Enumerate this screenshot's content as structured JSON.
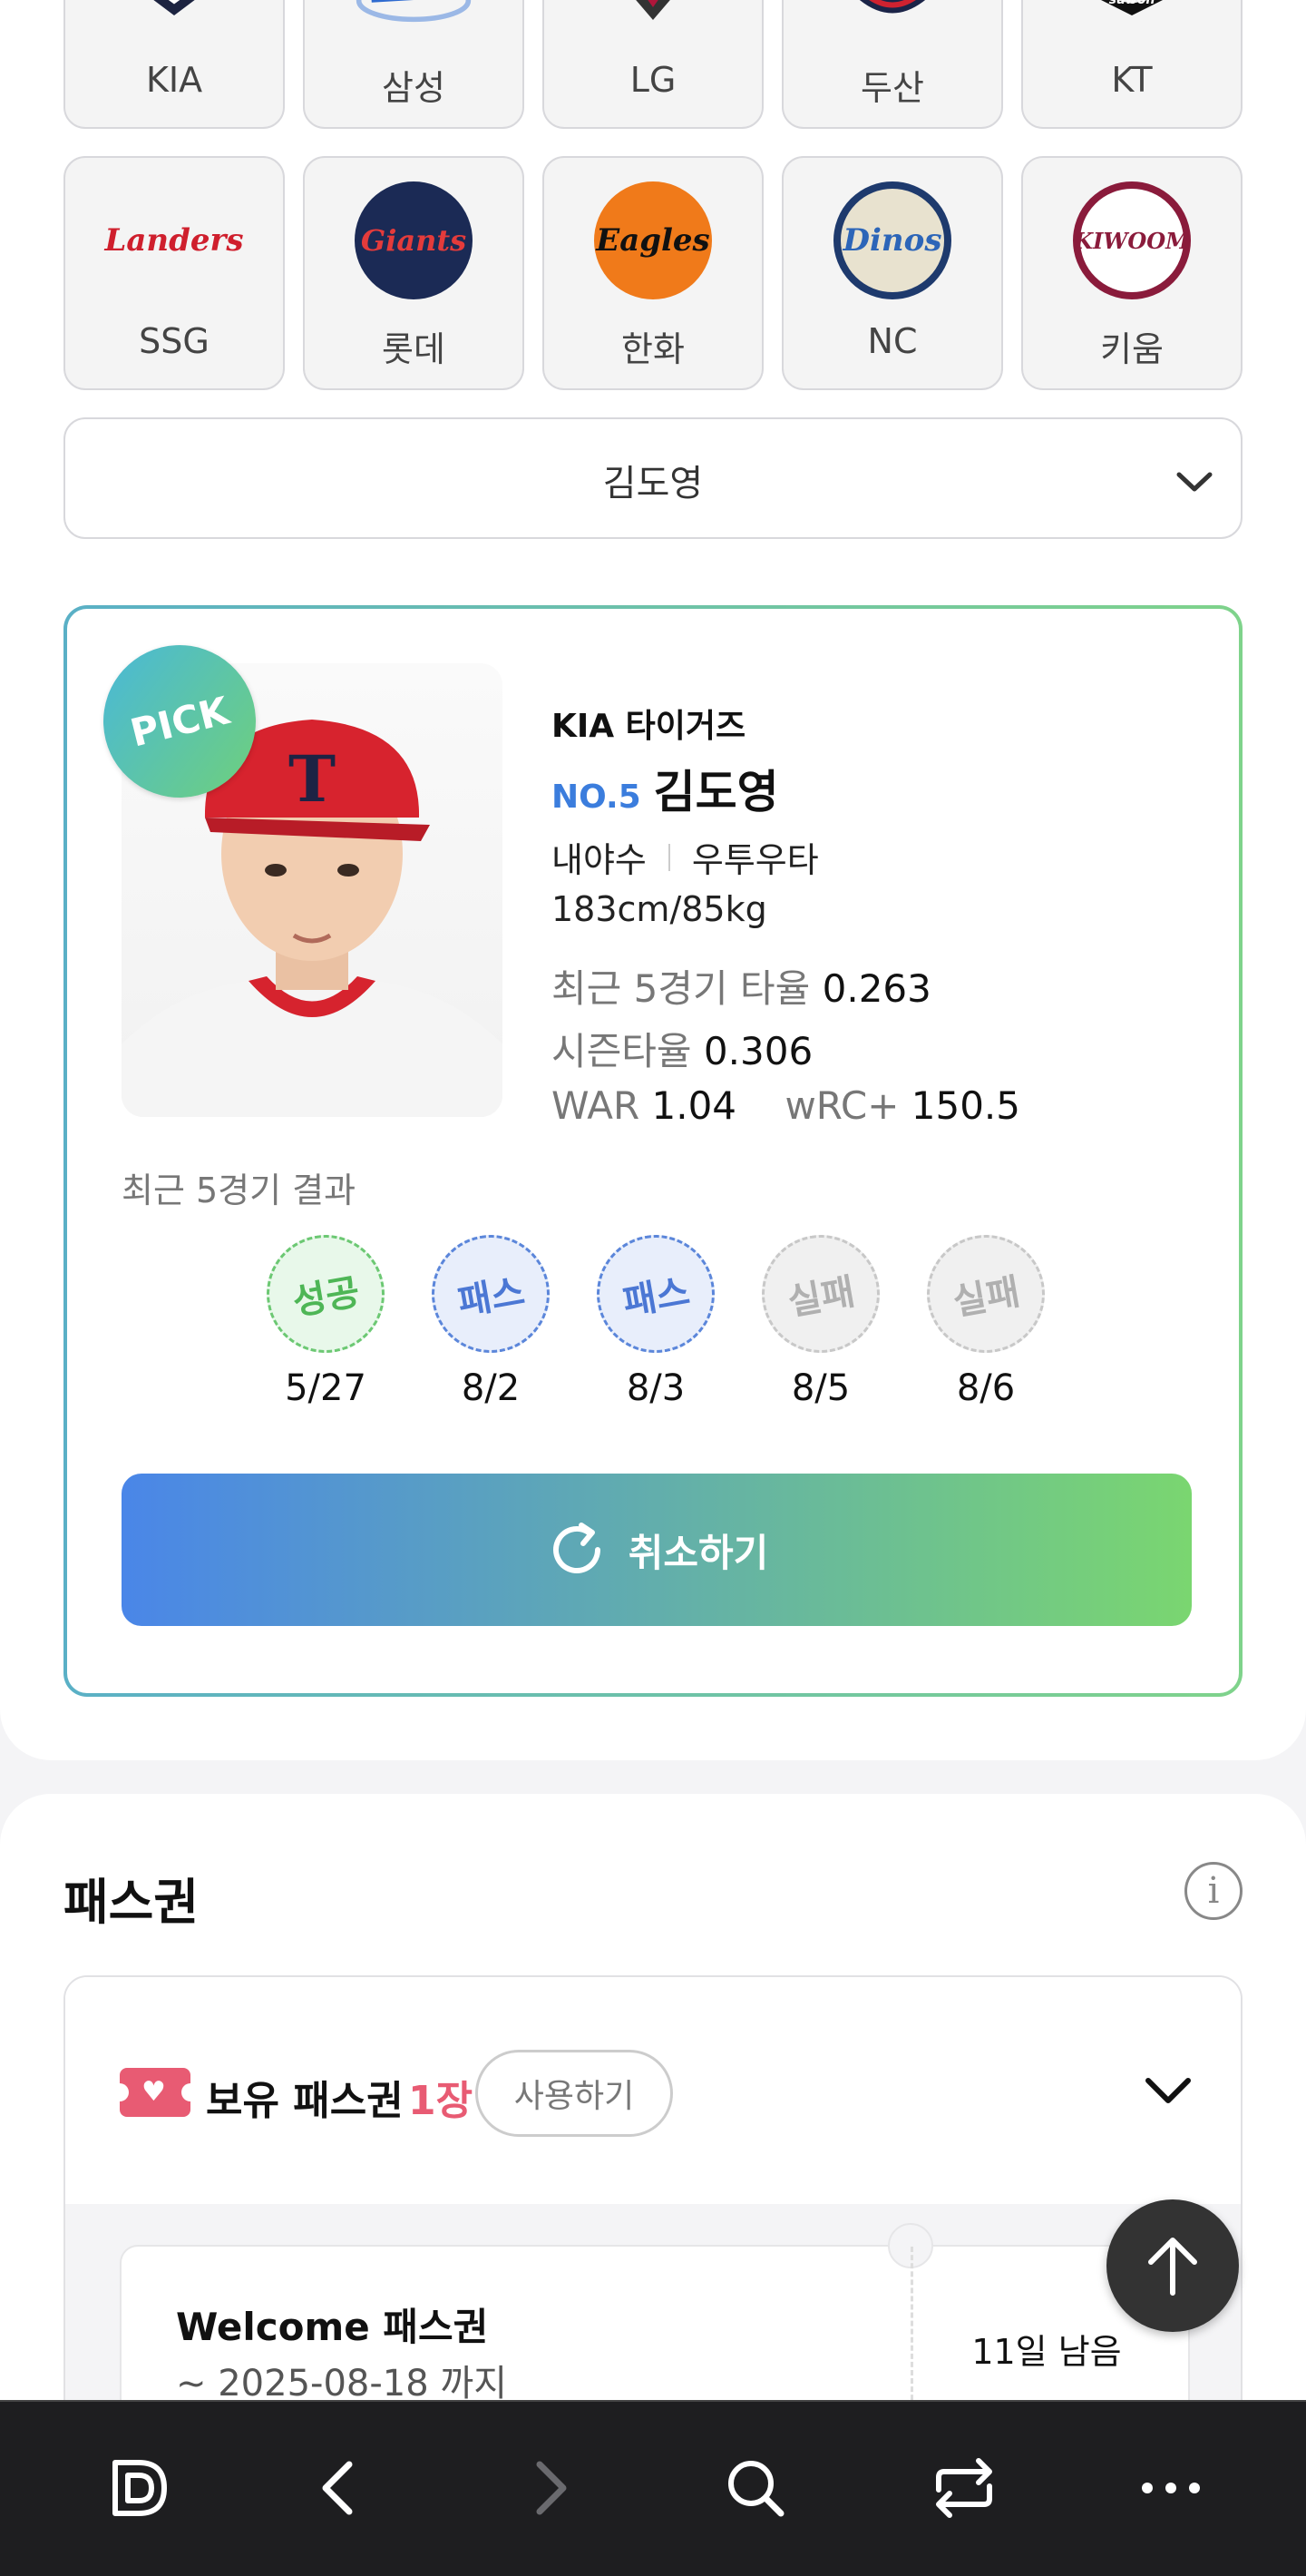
{
  "teams": [
    {
      "name": "KIA",
      "logo_text": "",
      "color": "#1c2340"
    },
    {
      "name": "삼성",
      "logo_text": "",
      "color": "#2f6bd0"
    },
    {
      "name": "LG",
      "logo_text": "",
      "color": "#b0163b"
    },
    {
      "name": "두산",
      "logo_text": "",
      "color": "#1b2448"
    },
    {
      "name": "KT",
      "logo_text": "",
      "color": "#111111"
    },
    {
      "name": "SSG",
      "logo_text": "Landers",
      "color": "#cf1f2d"
    },
    {
      "name": "롯데",
      "logo_text": "Giants",
      "color": "#d8202a"
    },
    {
      "name": "한화",
      "logo_text": "Eagles",
      "color": "#f07a1a"
    },
    {
      "name": "NC",
      "logo_text": "Dinos",
      "color": "#1e3a6d"
    },
    {
      "name": "키움",
      "logo_text": "KIWOOM",
      "color": "#8a1b3b"
    }
  ],
  "player_select": {
    "value": "김도영"
  },
  "pick_card": {
    "badge": "PICK",
    "team_name": "KIA 타이거즈",
    "number": "NO.5",
    "player_name": "김도영",
    "position": "내야수",
    "bats_throws": "우투우타",
    "body": "183cm/85kg",
    "stats": {
      "recent5_label": "최근 5경기 타율",
      "recent5_value": "0.263",
      "season_label": "시즌타율",
      "season_value": "0.306",
      "war_label": "WAR",
      "war_value": "1.04",
      "wrc_label": "wRC+",
      "wrc_value": "150.5"
    },
    "recent_results_label": "최근 5경기 결과",
    "results": [
      {
        "status": "성공",
        "date": "5/27",
        "type": "success"
      },
      {
        "status": "패스",
        "date": "8/2",
        "type": "pass"
      },
      {
        "status": "패스",
        "date": "8/3",
        "type": "pass"
      },
      {
        "status": "실패",
        "date": "8/5",
        "type": "fail"
      },
      {
        "status": "실패",
        "date": "8/6",
        "type": "fail"
      }
    ],
    "cancel_label": "취소하기"
  },
  "pass_section": {
    "title": "패스권",
    "info_icon": "i",
    "hold_label": "보유 패스권",
    "hold_count": "1장",
    "use_label": "사용하기",
    "tickets": [
      {
        "title": "Welcome 패스권",
        "expiry": "~ 2025-08-18 까지",
        "remaining": "11일 남음"
      }
    ]
  },
  "bottom_nav": [
    "d-logo-icon",
    "back-icon",
    "forward-icon",
    "search-icon",
    "switch-icon",
    "more-icon"
  ]
}
